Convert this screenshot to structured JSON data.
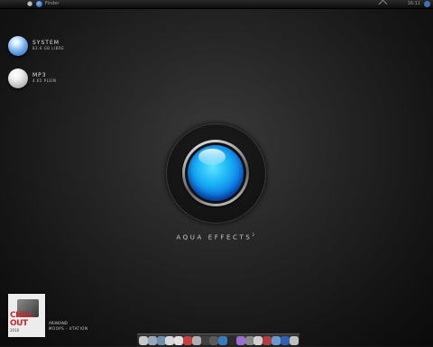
{
  "menubar": {
    "app_label": "Finder",
    "clock": "16:11"
  },
  "desktop_icons": [
    {
      "name": "SYSTEM",
      "sub": "83.6 GB LIBRE"
    },
    {
      "name": "MP3",
      "sub": "4.65 PLEIN"
    }
  ],
  "center_logo": {
    "brand": "AQUA EFFECTS",
    "superscript": "2"
  },
  "album": {
    "cover_line1": "CHILL",
    "cover_line2": "OUT",
    "cover_line3": "2010",
    "artist": "ARIAKAND",
    "track": "MOOPS - UTATION"
  },
  "dock": {
    "items": [
      {
        "icon": "finder-icon",
        "color": "#c8c8c8"
      },
      {
        "icon": "mail-icon",
        "color": "#9aa8b8"
      },
      {
        "icon": "safari-icon",
        "color": "#6f8fb0"
      },
      {
        "icon": "itunes-icon",
        "color": "#d8d8d8"
      },
      {
        "icon": "chat-icon",
        "color": "#e0e0e0"
      },
      {
        "icon": "photo-icon",
        "color": "#c84040"
      },
      {
        "icon": "media-icon",
        "color": "#b0b0b0"
      },
      {
        "icon": "app-icon",
        "color": "#404040"
      },
      {
        "icon": "app-icon",
        "color": "#5a5a5a"
      },
      {
        "icon": "globe-icon",
        "color": "#3a7ac0"
      },
      {
        "icon": "app-icon",
        "color": "#2a2a2a"
      },
      {
        "icon": "music-icon",
        "color": "#9b6fd0"
      },
      {
        "icon": "app-icon",
        "color": "#888888"
      },
      {
        "icon": "folder-icon",
        "color": "#d0d0d0"
      },
      {
        "icon": "app-icon",
        "color": "#b04040"
      },
      {
        "icon": "app-icon",
        "color": "#6a9ad0"
      },
      {
        "icon": "app-icon",
        "color": "#3060b0"
      },
      {
        "icon": "trash-icon",
        "color": "#c0c0c0"
      }
    ]
  }
}
